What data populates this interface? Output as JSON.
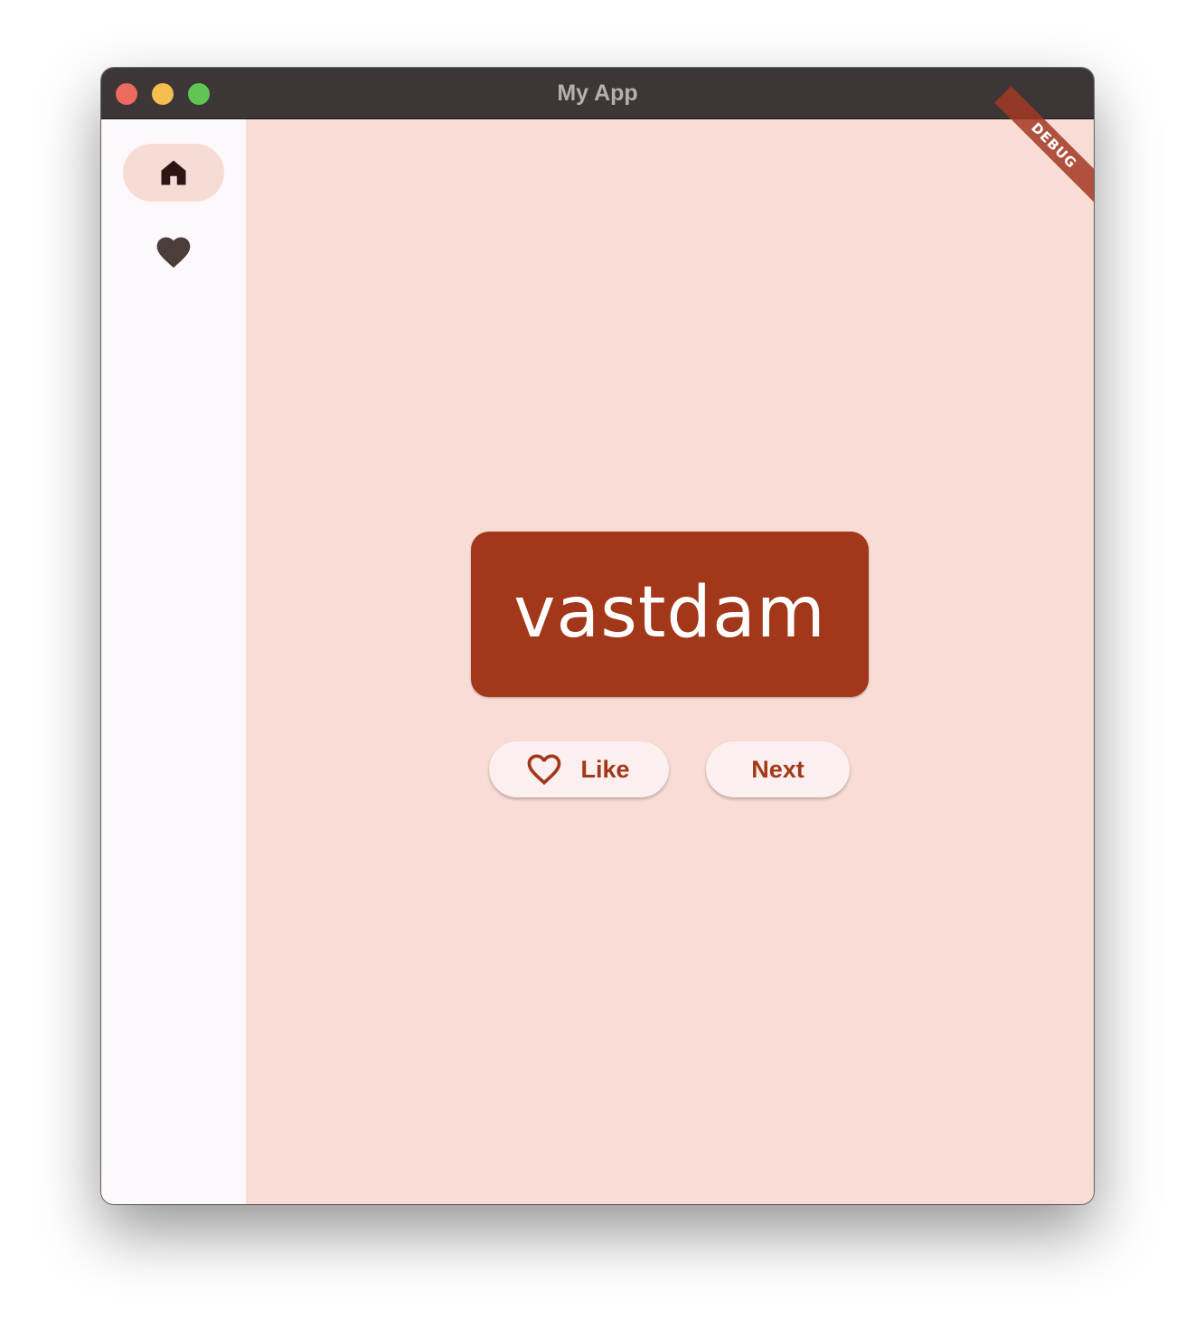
{
  "window": {
    "title": "My App"
  },
  "navigation_rail": {
    "items": [
      {
        "icon": "home-icon",
        "selected": true
      },
      {
        "icon": "heart-icon",
        "selected": false
      }
    ]
  },
  "main": {
    "current_word": "vastdam",
    "like_label": "Like",
    "next_label": "Next"
  },
  "debug_banner": "DEBUG",
  "colors": {
    "titlebar": "#3d3636",
    "rail_background": "#fdf8fb",
    "main_background": "#f8dcd5",
    "card_background": "#a23819",
    "accent": "#a23819",
    "button_background": "#fbeff0"
  }
}
